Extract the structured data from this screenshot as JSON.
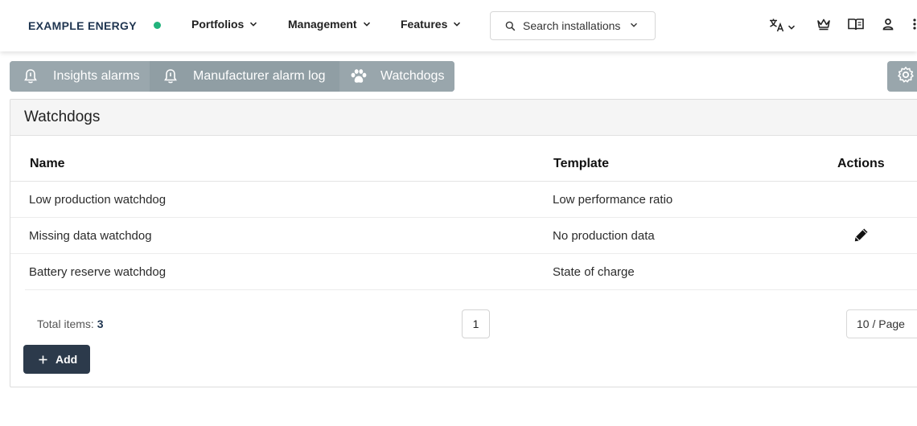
{
  "navbar": {
    "brand": "EXAMPLE ENERGY",
    "status_color": "#22b37c",
    "menus": [
      {
        "label": "Portfolios",
        "icon": "chevron-down-icon"
      },
      {
        "label": "Management",
        "icon": "chevron-down-icon"
      },
      {
        "label": "Features",
        "icon": "chevron-down-icon"
      }
    ],
    "search": {
      "label": "Search installations",
      "icon": "search-icon"
    },
    "right_icons": [
      "translate-icon",
      "crown-icon",
      "book-icon",
      "user-icon",
      "more-icon"
    ]
  },
  "tabs": [
    {
      "label": "Insights alarms",
      "icon": "bell-icon"
    },
    {
      "label": "Manufacturer alarm log",
      "icon": "bell-icon"
    },
    {
      "label": "Watchdogs",
      "icon": "paw-icon"
    }
  ],
  "card": {
    "title": "Watchdogs",
    "columns": {
      "name": "Name",
      "template": "Template",
      "actions": "Actions"
    },
    "rows": [
      {
        "name": "Low production watchdog",
        "template": "Low performance ratio"
      },
      {
        "name": "Missing data watchdog",
        "template": "No production data",
        "action_icon": "pencil-icon"
      },
      {
        "name": "Battery reserve watchdog",
        "template": "State of charge"
      }
    ],
    "total_label": "Total items:",
    "total_count": "3",
    "current_page": "1",
    "page_size": "10 / Page",
    "add_label": "Add"
  },
  "colors": {
    "brand": "#1f3550",
    "tab_bg": "#99a6ac",
    "add_button": "#2c3a4b"
  }
}
